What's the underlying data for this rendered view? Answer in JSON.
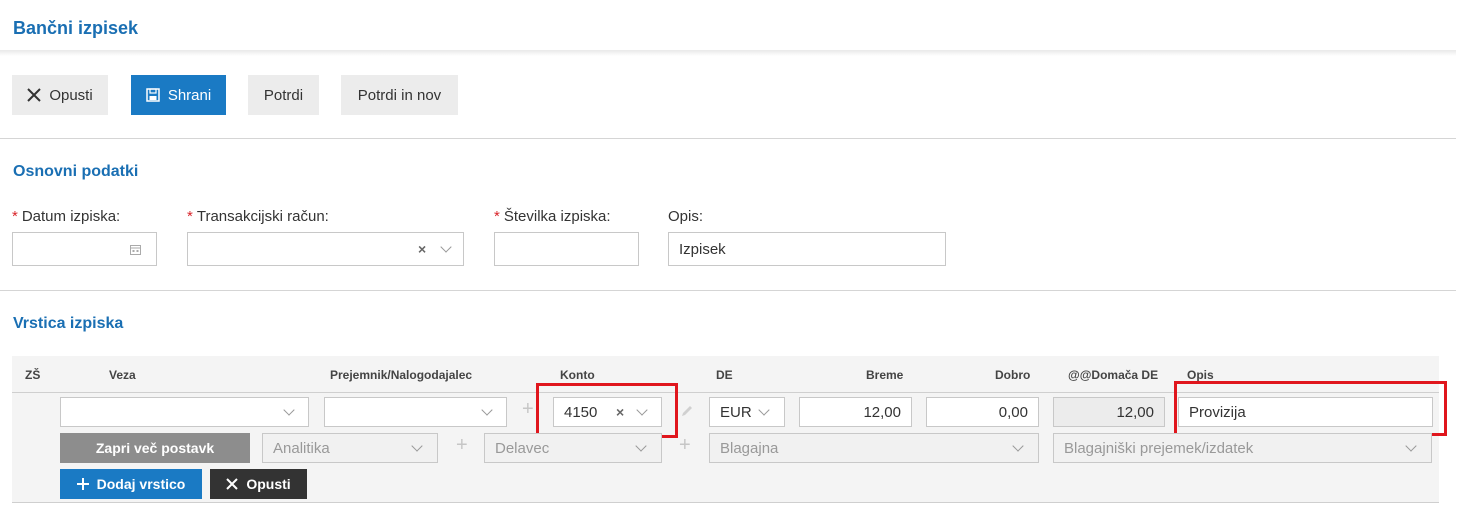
{
  "header": {
    "title": "Bančni izpisek"
  },
  "toolbar": {
    "discard_label": "Opusti",
    "save_label": "Shrani",
    "confirm_label": "Potrdi",
    "confirm_new_label": "Potrdi in nov"
  },
  "basic": {
    "title": "Osnovni podatki",
    "date_label": "Datum izpiska:",
    "account_label": "Transakcijski račun:",
    "number_label": "Številka izpiska:",
    "desc_label": "Opis:",
    "desc_value": "Izpisek",
    "required_mark": "*"
  },
  "lines": {
    "title": "Vrstica izpiska",
    "columns": [
      "ZŠ",
      "Veza",
      "Prejemnik/Nalogodajalec",
      "Konto",
      "DE",
      "Breme",
      "Dobro",
      "@@Domača DE",
      "Opis"
    ],
    "row": {
      "konto": "4150",
      "currency": "EUR",
      "debit": "12,00",
      "credit": "0,00",
      "domestic": "12,00",
      "description": "Provizija"
    },
    "close_more_label": "Zapri več postavk",
    "analytics_placeholder": "Analitika",
    "employee_placeholder": "Delavec",
    "cashbox_placeholder": "Blagajna",
    "cash_doc_placeholder": "Blagajniški prejemek/izdatek",
    "add_row_label": "Dodaj vrstico",
    "discard_label": "Opusti"
  },
  "colors": {
    "accent": "#1a7ac4",
    "title": "#1a6fb3",
    "highlight": "#e0161d"
  },
  "icons": [
    "close-icon",
    "save-icon",
    "calendar-icon",
    "chevron-down-icon",
    "clear-icon",
    "plus-icon",
    "pencil-icon"
  ]
}
